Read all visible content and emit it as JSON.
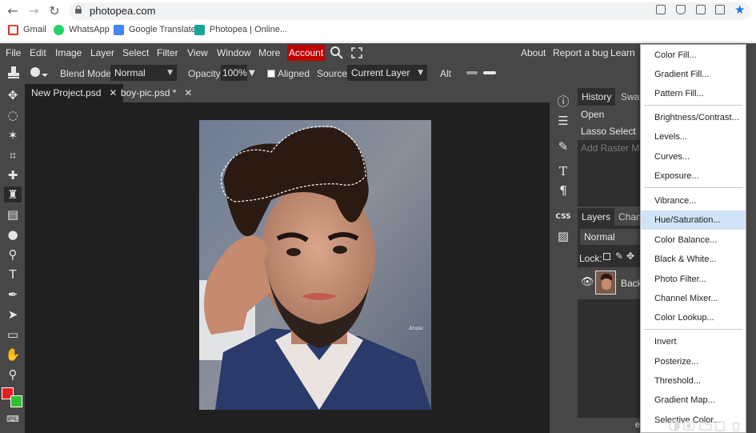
{
  "browser": {
    "url": "photopea.com",
    "bookmarks": [
      {
        "label": "Gmail",
        "icon": "gmail-icon"
      },
      {
        "label": "WhatsApp",
        "icon": "whatsapp-icon"
      },
      {
        "label": "Google Translate",
        "icon": "translate-icon"
      },
      {
        "label": "Photopea | Online...",
        "icon": "photopea-icon"
      }
    ]
  },
  "menubar": {
    "items": [
      "File",
      "Edit",
      "Image",
      "Layer",
      "Select",
      "Filter",
      "View",
      "Window",
      "More"
    ],
    "account": "Account",
    "right_items": [
      "About",
      "Report a bug",
      "Learn"
    ]
  },
  "options": {
    "blend_mode_label": "Blend Mode:",
    "blend_mode_value": "Normal",
    "opacity_label": "Opacity:",
    "opacity_value": "100%",
    "aligned_label": "Aligned",
    "source_label": "Source:",
    "source_value": "Current Layer",
    "alt_label": "Alt"
  },
  "doc_tabs": [
    {
      "label": "New Project.psd",
      "active": true
    },
    {
      "label": "boy-pic.psd *",
      "active": false
    }
  ],
  "canvas": {
    "signature": "Arasu"
  },
  "history_panel": {
    "tabs": [
      "History",
      "Swat"
    ],
    "rows": [
      "Open",
      "Lasso Select",
      "Add Raster Mas"
    ]
  },
  "layers_panel": {
    "tabs": [
      "Layers",
      "Chan"
    ],
    "blend": "Normal",
    "lock_label": "Lock:",
    "layer_name": "Back"
  },
  "adjustment_menu": {
    "groups": [
      [
        "Color Fill...",
        "Gradient Fill...",
        "Pattern Fill..."
      ],
      [
        "Brightness/Contrast...",
        "Levels...",
        "Curves...",
        "Exposure..."
      ],
      [
        "Vibrance...",
        "Hue/Saturation...",
        "Color Balance...",
        "Black & White...",
        "Photo Filter...",
        "Channel Mixer...",
        "Color Lookup..."
      ],
      [
        "Invert",
        "Posterize...",
        "Threshold...",
        "Gradient Map...",
        "Selective Color..."
      ]
    ],
    "highlighted": "Hue/Saturation..."
  },
  "panel_footer": {
    "eff_label": "eff"
  },
  "colors": {
    "app_bg": "#474747",
    "canvas_bg": "#202020",
    "account_red": "#c00000",
    "foreground_color": "#e02020",
    "background_color": "#2ec02e",
    "menu_highlight": "#d0e3f7"
  }
}
